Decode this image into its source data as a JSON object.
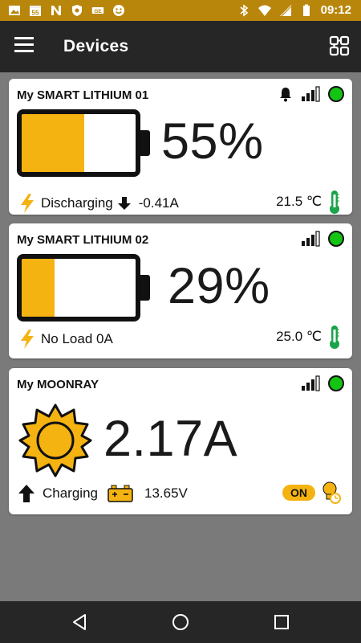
{
  "status_bar": {
    "time": "09:12",
    "left_icons": [
      "image-icon",
      "calendar-icon",
      "n-app-icon",
      "shield-icon",
      "ge-app-icon",
      "smiley-icon"
    ],
    "calendar_day": "55",
    "ge_text": "GE",
    "right_icons": [
      "bluetooth-icon",
      "wifi-icon",
      "signal-icon",
      "battery-icon"
    ]
  },
  "app_bar": {
    "title": "Devices",
    "menu_icon": "hamburger-menu-icon",
    "scan_icon": "scan-devices-icon"
  },
  "devices": [
    {
      "name": "My SMART LITHIUM 01",
      "type": "battery",
      "percent_text": "55%",
      "charge_level": 0.55,
      "state_label": "Discharging",
      "current_direction": "down",
      "current": "-0.41A",
      "temperature": "21.5 ℃",
      "alarm": true,
      "connected": true
    },
    {
      "name": "My SMART LITHIUM 02",
      "type": "battery",
      "percent_text": "29%",
      "charge_level": 0.29,
      "state_label": "No Load 0A",
      "temperature": "25.0 ℃",
      "alarm": false,
      "connected": true
    },
    {
      "name": "My MOONRAY",
      "type": "solar",
      "current_text": "2.17A",
      "state_label": "Charging",
      "voltage": "13.65V",
      "output_badge": "ON",
      "connected": true
    }
  ],
  "colors": {
    "accent": "#f5b311",
    "status_bar": "#b8860b",
    "app_bar": "#262626",
    "connected": "#13c413",
    "thermometer": "#1aa34a"
  },
  "nav_bar": {
    "buttons": [
      "back-icon",
      "home-icon",
      "recents-icon"
    ]
  }
}
